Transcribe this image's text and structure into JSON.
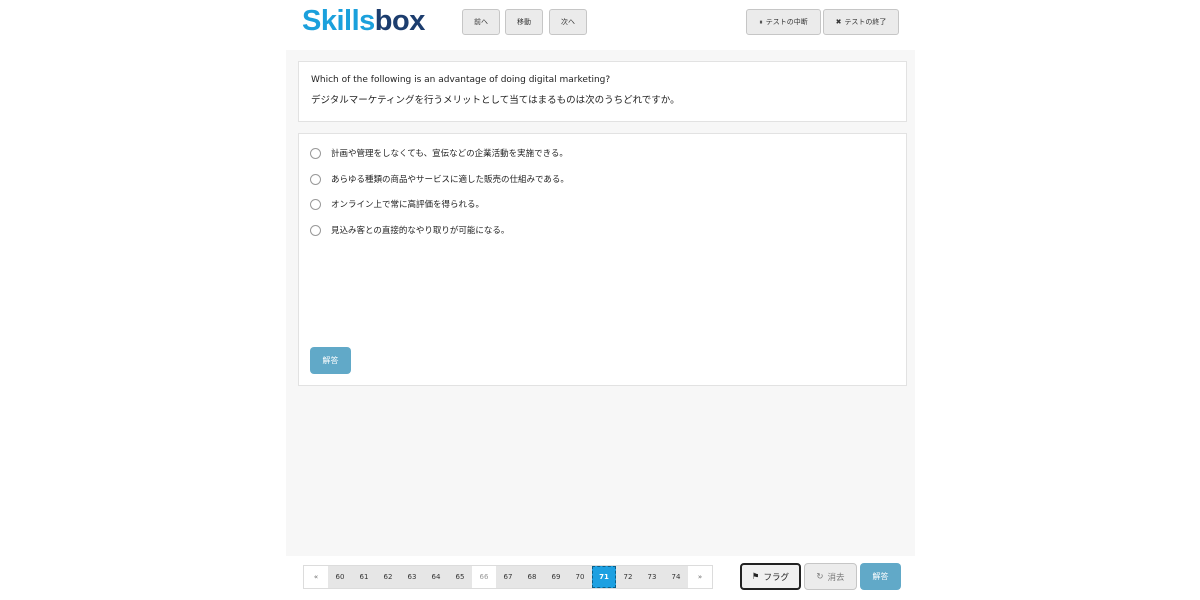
{
  "app": {
    "logo_part1": "Skills",
    "logo_part2": "box"
  },
  "toolbar": {
    "prev_label": "前へ",
    "move_label": "移動",
    "next_label": "次へ",
    "pause_icon": "⏸",
    "pause_label": "テストの中断",
    "end_icon": "✖",
    "end_label": "テストの終了"
  },
  "question": {
    "text_en": "Which of the following is an advantage of doing digital marketing?",
    "text_ja": "デジタルマーケティングを行うメリットとして当てはまるものは次のうちどれですか。"
  },
  "options": [
    "計画や管理をしなくても、宣伝などの企業活動を実施できる。",
    "あらゆる種類の商品やサービスに適した販売の仕組みである。",
    "オンライン上で常に高評価を得られる。",
    "見込み客との直接的なやり取りが可能になる。"
  ],
  "answer_label": "解答",
  "pagination": {
    "prev": "«",
    "next": "»",
    "pages": [
      "60",
      "61",
      "62",
      "63",
      "64",
      "65",
      "66",
      "67",
      "68",
      "69",
      "70",
      "71",
      "72",
      "73",
      "74"
    ],
    "current": "71"
  },
  "bottom": {
    "flag_icon": "⚑",
    "flag_label": "フラグ",
    "clear_icon": "↻",
    "clear_label": "消去",
    "answer_label": "解答"
  },
  "colors": {
    "brand_blue": "#1ba0dc",
    "brand_navy": "#1c3d6e",
    "answer_button": "#61a9c8",
    "current_page": "#1da0e1"
  }
}
